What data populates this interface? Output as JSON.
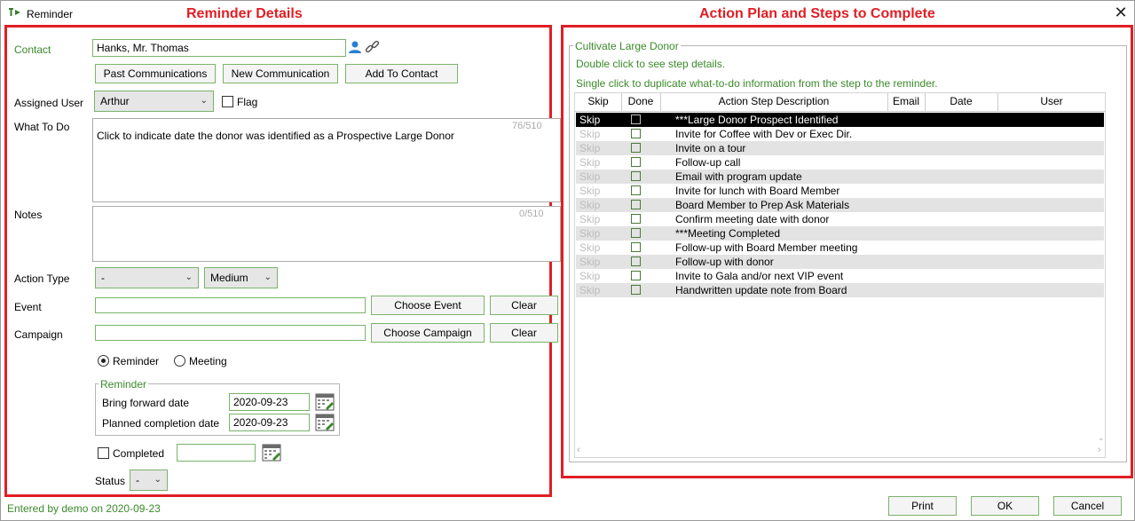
{
  "window": {
    "title": "Reminder",
    "icon": "reminder-app-icon",
    "close_glyph": "✕"
  },
  "annotations": {
    "left": "Reminder Details",
    "right": "Action Plan and Steps to Complete"
  },
  "contact": {
    "label": "Contact",
    "value": "Hanks, Mr. Thomas"
  },
  "contact_buttons": {
    "past": "Past Communications",
    "new": "New Communication",
    "add": "Add To Contact"
  },
  "assigned_user": {
    "label": "Assigned User",
    "value": "Arthur"
  },
  "flag": {
    "label": "Flag",
    "checked": false
  },
  "what_to_do": {
    "label": "What To Do",
    "counter": "76/510",
    "text": "Click to indicate date the donor was identified as a Prospective Large Donor"
  },
  "notes": {
    "label": "Notes",
    "counter": "0/510",
    "text": ""
  },
  "action_type": {
    "label": "Action Type",
    "value": "-",
    "priority": "Medium"
  },
  "event": {
    "label": "Event",
    "value": "",
    "choose_label": "Choose Event",
    "clear_label": "Clear"
  },
  "campaign": {
    "label": "Campaign",
    "value": "",
    "choose_label": "Choose Campaign",
    "clear_label": "Clear"
  },
  "mode": {
    "reminder_label": "Reminder",
    "meeting_label": "Meeting",
    "selected": "Reminder"
  },
  "reminder_group": {
    "title": "Reminder",
    "bring_forward_label": "Bring forward date",
    "bring_forward_value": "2020-09-23",
    "planned_label": "Planned completion date",
    "planned_value": "2020-09-23"
  },
  "completed": {
    "label": "Completed",
    "checked": false,
    "value": ""
  },
  "status": {
    "label": "Status",
    "value": "-"
  },
  "plan": {
    "title": "Cultivate Large Donor",
    "hint1": "Double click to see step details.",
    "hint2": "Single click to duplicate what-to-do information from the step to the reminder.",
    "columns": [
      "Skip",
      "Done",
      "Action Step Description",
      "Email",
      "Date",
      "User"
    ],
    "rows": [
      {
        "skip": "Skip",
        "desc": "***Large Donor Prospect Identified",
        "selected": true
      },
      {
        "skip": "Skip",
        "desc": "Invite for Coffee with Dev or Exec Dir."
      },
      {
        "skip": "Skip",
        "desc": "Invite on a tour"
      },
      {
        "skip": "Skip",
        "desc": "Follow-up call"
      },
      {
        "skip": "Skip",
        "desc": "Email with program update"
      },
      {
        "skip": "Skip",
        "desc": "Invite for lunch with Board Member"
      },
      {
        "skip": "Skip",
        "desc": "Board Member to Prep Ask Materials"
      },
      {
        "skip": "Skip",
        "desc": "Confirm meeting date with donor"
      },
      {
        "skip": "Skip",
        "desc": "***Meeting Completed"
      },
      {
        "skip": "Skip",
        "desc": "Follow-up with Board Member meeting"
      },
      {
        "skip": "Skip",
        "desc": "Follow-up with donor"
      },
      {
        "skip": "Skip",
        "desc": "Invite to Gala and/or next VIP event"
      },
      {
        "skip": "Skip",
        "desc": "Handwritten update note from Board"
      }
    ]
  },
  "footer": {
    "entered_by": "Entered by demo on 2020-09-23",
    "print": "Print",
    "ok": "OK",
    "cancel": "Cancel"
  },
  "colors": {
    "accent_green": "#3a8a2a",
    "border_green": "#7bb36b",
    "annotation_red": "#e01e24",
    "selected_row": "#000000",
    "alt_row": "#e3e3e3"
  }
}
